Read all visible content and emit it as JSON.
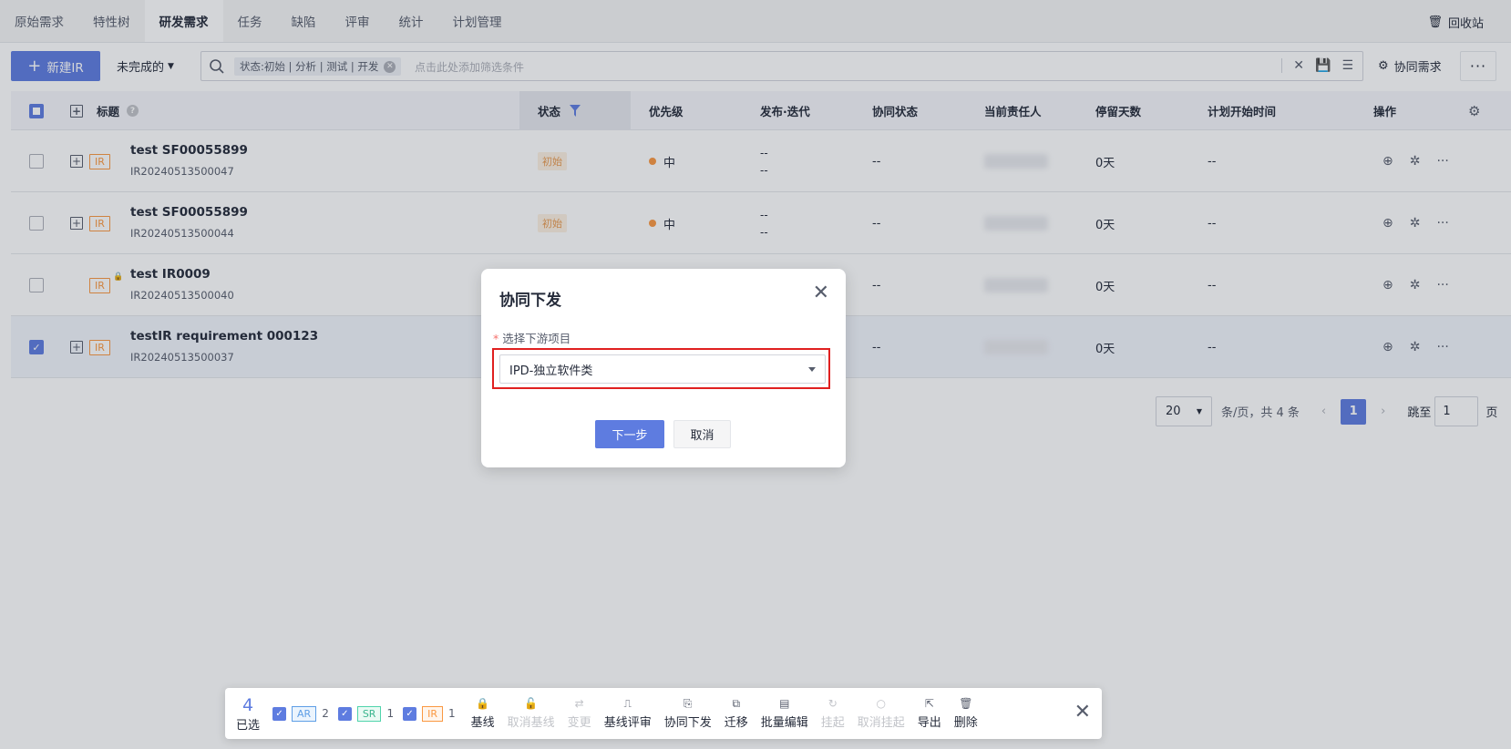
{
  "tabs": [
    "原始需求",
    "特性树",
    "研发需求",
    "任务",
    "缺陷",
    "评审",
    "统计",
    "计划管理"
  ],
  "active_tab_index": 2,
  "recycle_label": "回收站",
  "toolbar": {
    "new_label": "新建IR",
    "filter_label": "未完成的",
    "chip_label": "状态:初始 | 分析 | 测试 | 开发",
    "search_placeholder": "点击此处添加筛选条件",
    "collab_label": "协同需求"
  },
  "columns": {
    "title": "标题",
    "status": "状态",
    "priority": "优先级",
    "release": "发布·迭代",
    "collab_status": "协同状态",
    "owner": "当前责任人",
    "stay_days": "停留天数",
    "plan_start": "计划开始时间",
    "ops": "操作"
  },
  "rows": [
    {
      "title": "test SF00055899",
      "id": "IR20240513500047",
      "type": "IR",
      "status": "初始",
      "priority": "中",
      "release1": "--",
      "release2": "--",
      "collab": "--",
      "days": "0天",
      "plan": "--"
    },
    {
      "title": "test SF00055899",
      "id": "IR20240513500044",
      "type": "IR",
      "status": "初始",
      "priority": "中",
      "release1": "--",
      "release2": "--",
      "collab": "--",
      "days": "0天",
      "plan": "--"
    },
    {
      "title": "test IR0009",
      "id": "IR20240513500040",
      "type": "IR",
      "status": "",
      "priority": "",
      "release1": "",
      "release2": "",
      "collab": "--",
      "days": "0天",
      "plan": "--"
    },
    {
      "title": "testIR requirement 000123",
      "id": "IR20240513500037",
      "type": "IR",
      "status": "",
      "priority": "",
      "release1": "",
      "release2": "",
      "collab": "--",
      "days": "0天",
      "plan": "--"
    }
  ],
  "pager": {
    "size": "20",
    "summary": "条/页，共 4 条",
    "current": "1",
    "jump_label": "跳至",
    "jump_value": "1",
    "page_unit": "页"
  },
  "dialog": {
    "title": "协同下发",
    "field_label": "选择下游项目",
    "required_mark": "*",
    "selected": "IPD-独立软件类",
    "next_label": "下一步",
    "cancel_label": "取消"
  },
  "batch": {
    "count": "4",
    "count_label": "已选",
    "types": [
      {
        "tag": "AR",
        "count": "2"
      },
      {
        "tag": "SR",
        "count": "1"
      },
      {
        "tag": "IR",
        "count": "1"
      }
    ],
    "actions": [
      {
        "label": "基线",
        "enabled": true,
        "icon": "lock-icon",
        "glyph": "🔒"
      },
      {
        "label": "取消基线",
        "enabled": false,
        "icon": "unlock-icon",
        "glyph": "🔓"
      },
      {
        "label": "变更",
        "enabled": false,
        "icon": "shuffle-icon",
        "glyph": "⇄"
      },
      {
        "label": "基线评审",
        "enabled": true,
        "icon": "stamp-icon",
        "glyph": "⎍"
      },
      {
        "label": "协同下发",
        "enabled": true,
        "icon": "doc-send-icon",
        "glyph": "⎘"
      },
      {
        "label": "迁移",
        "enabled": true,
        "icon": "move-icon",
        "glyph": "⧉"
      },
      {
        "label": "批量编辑",
        "enabled": true,
        "icon": "batch-edit-icon",
        "glyph": "▤"
      },
      {
        "label": "挂起",
        "enabled": false,
        "icon": "suspend-icon",
        "glyph": "↻"
      },
      {
        "label": "取消挂起",
        "enabled": false,
        "icon": "resume-icon",
        "glyph": "○"
      },
      {
        "label": "导出",
        "enabled": true,
        "icon": "export-icon",
        "glyph": "⇱"
      },
      {
        "label": "删除",
        "enabled": true,
        "icon": "trash-icon",
        "glyph": "🗑"
      }
    ]
  },
  "colors": {
    "primary": "#5e7ce0",
    "ir_tag": "#fa9841",
    "highlight": "#e02020"
  }
}
